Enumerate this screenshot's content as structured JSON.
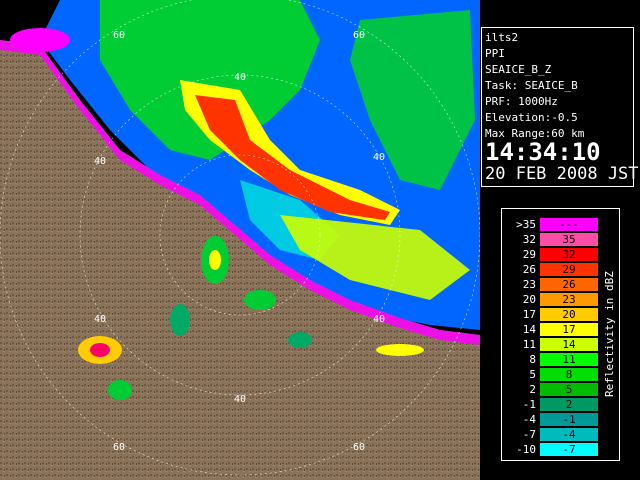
{
  "info": {
    "host": "ilts2",
    "scan_type": "PPI",
    "product": "SEAICE_B_Z",
    "task": "Task: SEAICE_B",
    "prf": "PRF: 1000Hz",
    "elevation": "Elevation:-0.5",
    "max_range": "Max Range:60 km",
    "time": "14:34:10",
    "date": "20 FEB 2008 JST"
  },
  "range_rings": [
    "60",
    "40",
    "40",
    "40",
    "40",
    "40",
    "60",
    "60"
  ],
  "legend": {
    "axis_label": "Reflectivity in dBZ",
    "rows": [
      {
        "lo": ">35",
        "hi": "---",
        "color": "#ff00ff"
      },
      {
        "lo": "32",
        "hi": "35",
        "color": "#ff4da6"
      },
      {
        "lo": "29",
        "hi": "32",
        "color": "#ff0000"
      },
      {
        "lo": "26",
        "hi": "29",
        "color": "#ff3300"
      },
      {
        "lo": "23",
        "hi": "26",
        "color": "#ff6600"
      },
      {
        "lo": "20",
        "hi": "23",
        "color": "#ff9900"
      },
      {
        "lo": "17",
        "hi": "20",
        "color": "#ffcc00"
      },
      {
        "lo": "14",
        "hi": "17",
        "color": "#ffff00"
      },
      {
        "lo": "11",
        "hi": "14",
        "color": "#ccff00"
      },
      {
        "lo": "8",
        "hi": "11",
        "color": "#00ff00"
      },
      {
        "lo": "5",
        "hi": "8",
        "color": "#00dd00"
      },
      {
        "lo": "2",
        "hi": "5",
        "color": "#00bb00"
      },
      {
        "lo": "-1",
        "hi": "2",
        "color": "#009966"
      },
      {
        "lo": "-4",
        "hi": "-1",
        "color": "#009999"
      },
      {
        "lo": "-7",
        "hi": "-4",
        "color": "#00bbbb"
      },
      {
        "lo": "-10",
        "hi": "-7",
        "color": "#00ffff"
      }
    ]
  },
  "colors": {
    "land": "#8a7358",
    "sea": "#0066ff",
    "background": "#000000"
  }
}
